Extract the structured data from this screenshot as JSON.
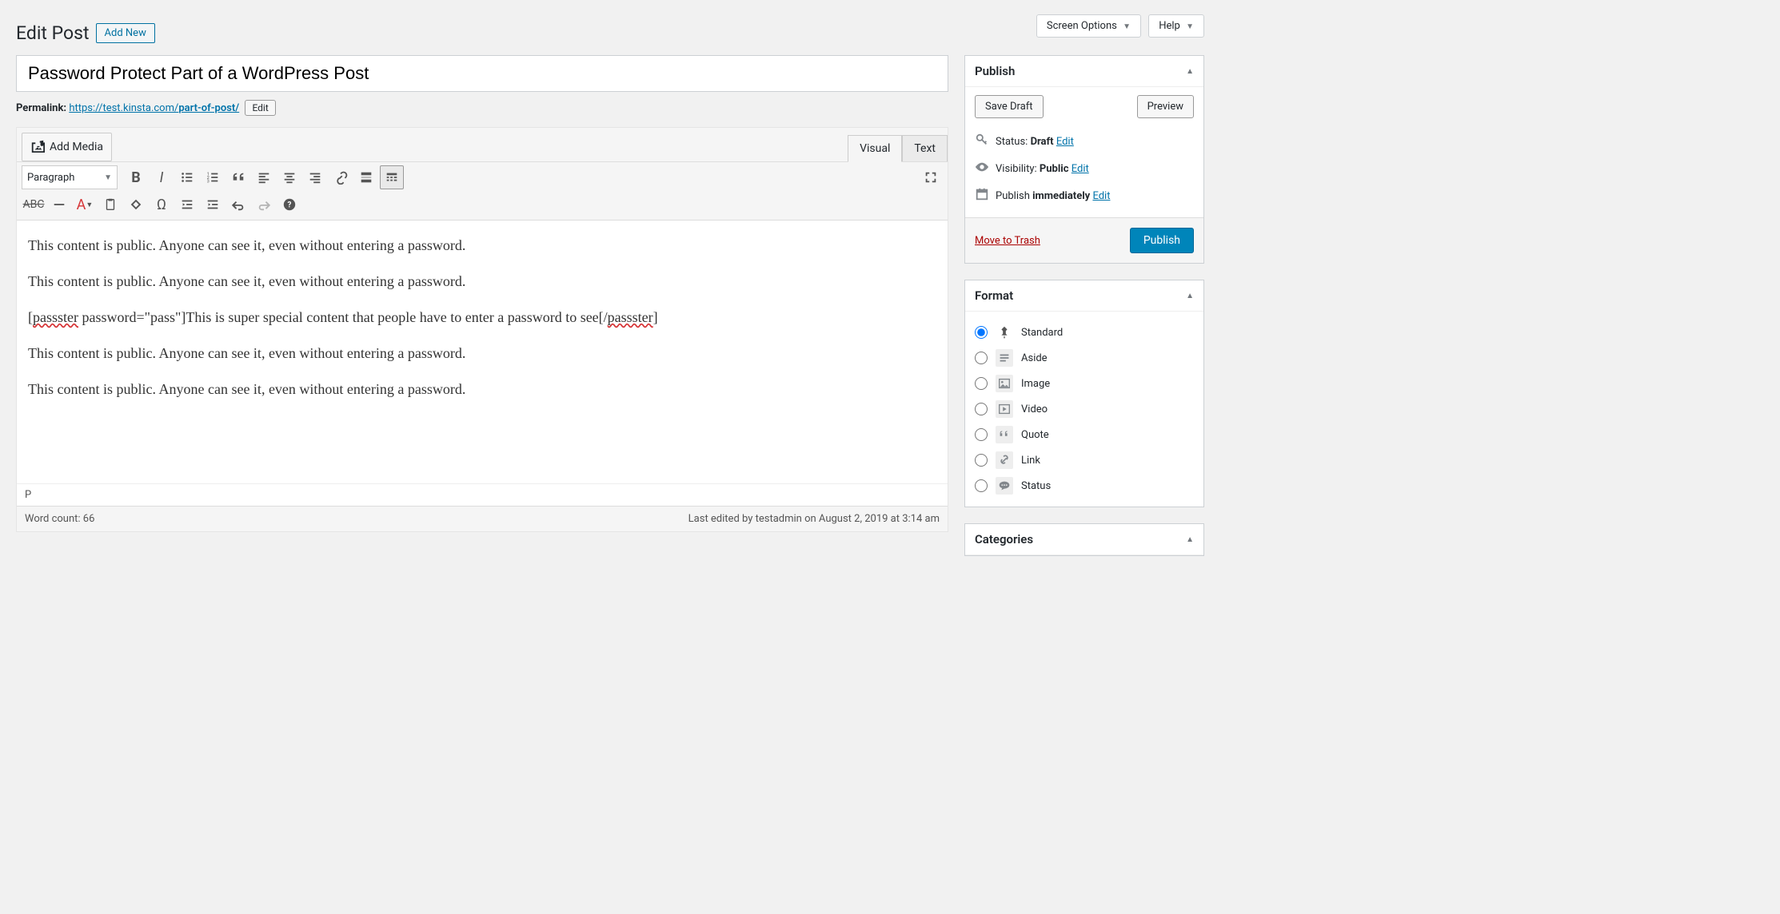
{
  "topTabs": {
    "screenOptions": "Screen Options",
    "help": "Help"
  },
  "header": {
    "title": "Edit Post",
    "addNew": "Add New"
  },
  "post": {
    "title": "Password Protect Part of a WordPress Post",
    "permalinkLabel": "Permalink:",
    "permalinkBase": "https://test.kinsta.com/",
    "permalinkSlug": "part-of-post/",
    "editBtn": "Edit"
  },
  "editor": {
    "addMedia": "Add Media",
    "tabs": {
      "visual": "Visual",
      "text": "Text"
    },
    "formatSelect": "Paragraph",
    "content": {
      "p1": "This content is public. Anyone can see it, even without entering a password.",
      "p2": "This content is public. Anyone can see it, even without entering a password.",
      "p3_pre": "[",
      "p3_tag1": "passster",
      "p3_mid": " password=\"pass\"]This is super special content that people have to enter a password to see[/",
      "p3_tag2": "passster",
      "p3_post": "]",
      "p4": "This content is public. Anyone can see it, even without entering a password.",
      "p5": "This content is public. Anyone can see it, even without entering a password."
    },
    "path": "P",
    "wordCount": "Word count: 66",
    "lastEdited": "Last edited by testadmin on August 2, 2019 at 3:14 am"
  },
  "publish": {
    "title": "Publish",
    "saveDraft": "Save Draft",
    "preview": "Preview",
    "statusLabel": "Status:",
    "statusValue": "Draft",
    "visibilityLabel": "Visibility:",
    "visibilityValue": "Public",
    "publishLabel": "Publish",
    "publishValue": "immediately",
    "editLink": "Edit",
    "trash": "Move to Trash",
    "publishBtn": "Publish"
  },
  "format": {
    "title": "Format",
    "options": [
      "Standard",
      "Aside",
      "Image",
      "Video",
      "Quote",
      "Link",
      "Status"
    ]
  },
  "categories": {
    "title": "Categories"
  }
}
